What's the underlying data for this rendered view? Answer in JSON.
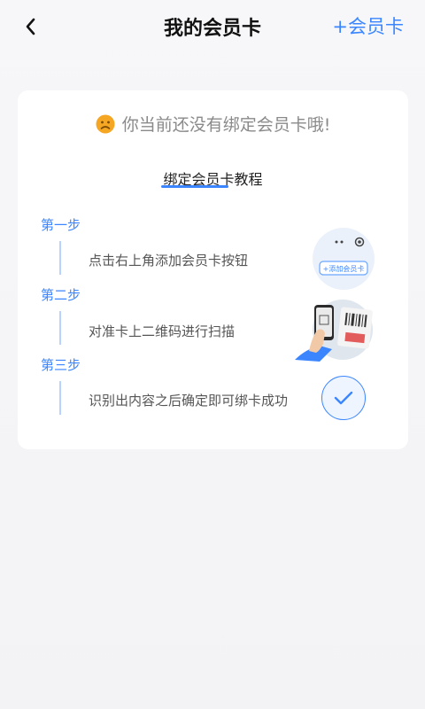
{
  "header": {
    "title": "我的会员卡",
    "add_label": "+会员卡"
  },
  "empty": {
    "message": "你当前还没有绑定会员卡哦!"
  },
  "tutorial": {
    "title": "绑定会员卡教程",
    "steps": [
      {
        "label": "第一步",
        "text": "点击右上角添加会员卡按钮"
      },
      {
        "label": "第二步",
        "text": "对准卡上二维码进行扫描"
      },
      {
        "label": "第三步",
        "text": "识别出内容之后确定即可绑卡成功"
      }
    ],
    "illustration_button": "+添加会员卡"
  },
  "colors": {
    "accent": "#3b86ff",
    "sad_face": "#f5a623"
  }
}
